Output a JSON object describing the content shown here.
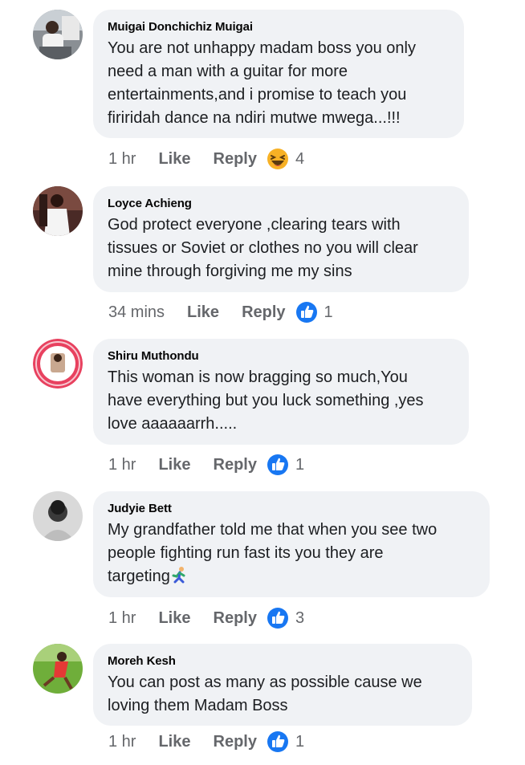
{
  "comments": [
    {
      "author": "Muigai Donchichiz Muigai",
      "text": "You are not unhappy madam boss you only\nneed a man with a guitar for more\nentertainments,and i promise to teach you\nfiriridah dance na ndiri mutwe mwega...!!!",
      "time": "1 hr",
      "like_label": "Like",
      "reply_label": "Reply",
      "reaction": "haha",
      "reaction_count": "4"
    },
    {
      "author": "Loyce Achieng",
      "text": "God  protect everyone ,clearing tears with\ntissues or Soviet or clothes no you will clear\nmine through forgiving me my sins",
      "time": "34 mins",
      "like_label": "Like",
      "reply_label": "Reply",
      "reaction": "like",
      "reaction_count": "1"
    },
    {
      "author": "Shiru Muthondu",
      "text": "This woman is now bragging so much,You\nhave everything but you luck something ,yes\nlove aaaaaarrh.....",
      "time": "1 hr",
      "like_label": "Like",
      "reply_label": "Reply",
      "reaction": "like",
      "reaction_count": "1"
    },
    {
      "author": "Judyie Bett",
      "text": "My grandfather told me that when you see two\npeople fighting run fast its you they are\ntargeting",
      "time": "1 hr",
      "like_label": "Like",
      "reply_label": "Reply",
      "reaction": "like",
      "reaction_count": "3"
    },
    {
      "author": "Moreh Kesh",
      "text": "You can post as many as possible cause we\nloving them Madam Boss",
      "time": "1 hr",
      "like_label": "Like",
      "reply_label": "Reply",
      "reaction": "like",
      "reaction_count": "1"
    }
  ],
  "colors": {
    "bubble": "#f0f2f5",
    "like_blue": "#1877f2",
    "meta_gray": "#65676b"
  }
}
